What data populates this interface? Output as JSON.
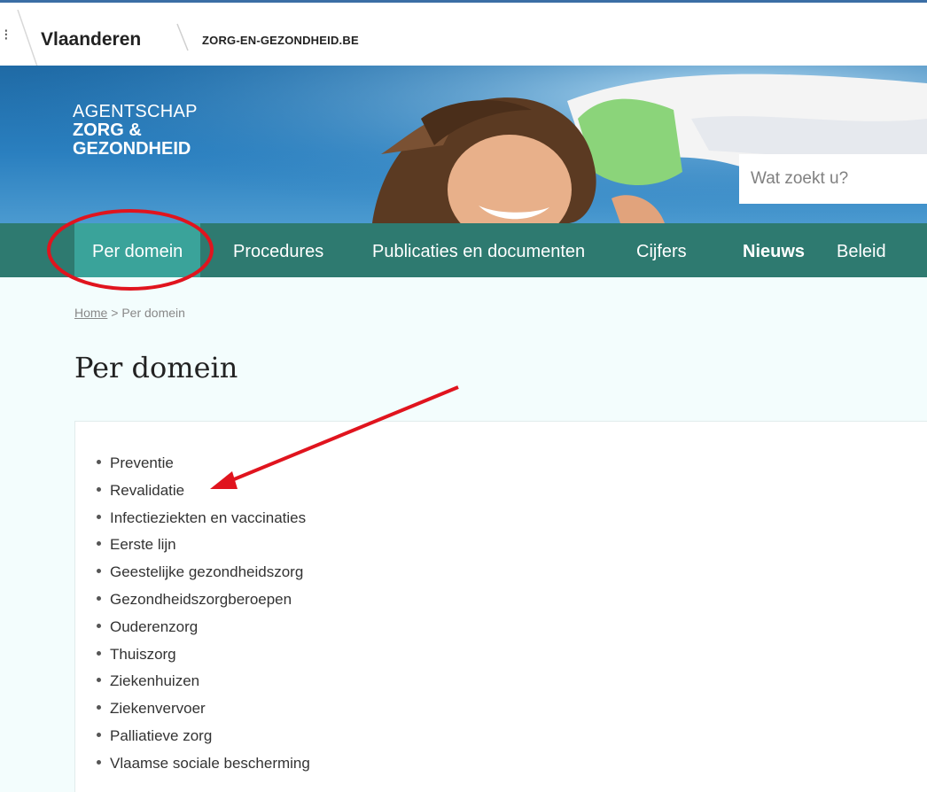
{
  "topbar": {
    "brand": "Vlaanderen",
    "site": "ZORG-EN-GEZONDHEID.BE",
    "edge_glyph": "⁝"
  },
  "hero": {
    "logo": {
      "line1": "AGENTSCHAP",
      "line2": "ZORG &",
      "line3": "GEZONDHEID"
    },
    "search_placeholder": "Wat zoekt u?"
  },
  "nav": {
    "items": [
      {
        "label": "Per domein",
        "active": true
      },
      {
        "label": "Procedures"
      },
      {
        "label": "Publicaties en documenten"
      },
      {
        "label": "Cijfers"
      },
      {
        "label": "Nieuws"
      },
      {
        "label": "Beleid"
      }
    ]
  },
  "breadcrumb": {
    "home": "Home",
    "separator": " > ",
    "current": "Per domein"
  },
  "page": {
    "title": "Per domein"
  },
  "domains": [
    "Preventie",
    "Revalidatie",
    "Infectieziekten en vaccinaties",
    "Eerste lijn",
    "Geestelijke gezondheidszorg",
    "Gezondheidszorgberoepen",
    "Ouderenzorg",
    "Thuiszorg",
    "Ziekenhuizen",
    "Ziekenvervoer",
    "Palliatieve zorg",
    "Vlaamse sociale bescherming"
  ],
  "colors": {
    "nav_bg": "#2e7a70",
    "nav_active": "#3aa39a",
    "annotation": "#e0141e",
    "page_bg": "#f3fdfd"
  }
}
